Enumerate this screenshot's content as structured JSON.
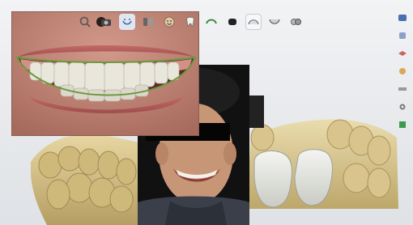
{
  "toolbar": {
    "buttons": [
      {
        "name": "zoom-icon"
      },
      {
        "name": "camera-icon"
      },
      {
        "name": "smile-design-icon"
      },
      {
        "name": "library-icon"
      },
      {
        "name": "face-icon"
      },
      {
        "name": "tooth-icon"
      },
      {
        "name": "teeth-arch-icon"
      },
      {
        "name": "jaw-icon"
      },
      {
        "name": "upper-arch-icon"
      },
      {
        "name": "lower-arch-icon"
      },
      {
        "name": "bite-icon"
      }
    ]
  },
  "right_panel": {
    "items": [
      "view-front-icon",
      "view-side-icon",
      "layer-icon",
      "color-icon",
      "measure-icon",
      "settings-icon",
      "export-icon"
    ]
  },
  "colors": {
    "background": "#e9ebee",
    "lip": "#b57768",
    "gum": "#c66a6a",
    "smile_outline": "#6a9a3a",
    "tooth": "#ecebe4",
    "stone_model": "#d6c38b",
    "restoration": "#e7e9e3"
  }
}
